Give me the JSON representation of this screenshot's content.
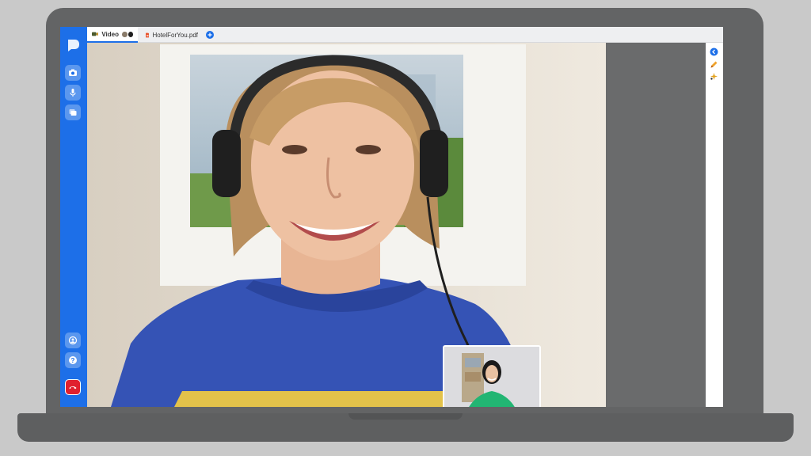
{
  "tabs": [
    {
      "label": "Video",
      "icon": "video-call-icon",
      "active": true
    },
    {
      "label": "HotelForYou.pdf",
      "icon": "pdf-icon",
      "active": false
    }
  ],
  "sidebar": {
    "top_buttons": [
      "camera-icon",
      "microphone-icon",
      "screen-share-icon"
    ],
    "bottom_buttons": [
      "settings-icon",
      "help-icon",
      "hang-up-icon"
    ]
  },
  "right_rail": [
    "collapse-arrow-icon",
    "pencil-icon",
    "sparkle-icon"
  ],
  "colors": {
    "brand_blue": "#1d6fe8",
    "hangup_red": "#e0202e",
    "sweater_blue": "#3553b5",
    "sweater_yellow": "#e3c24a"
  }
}
